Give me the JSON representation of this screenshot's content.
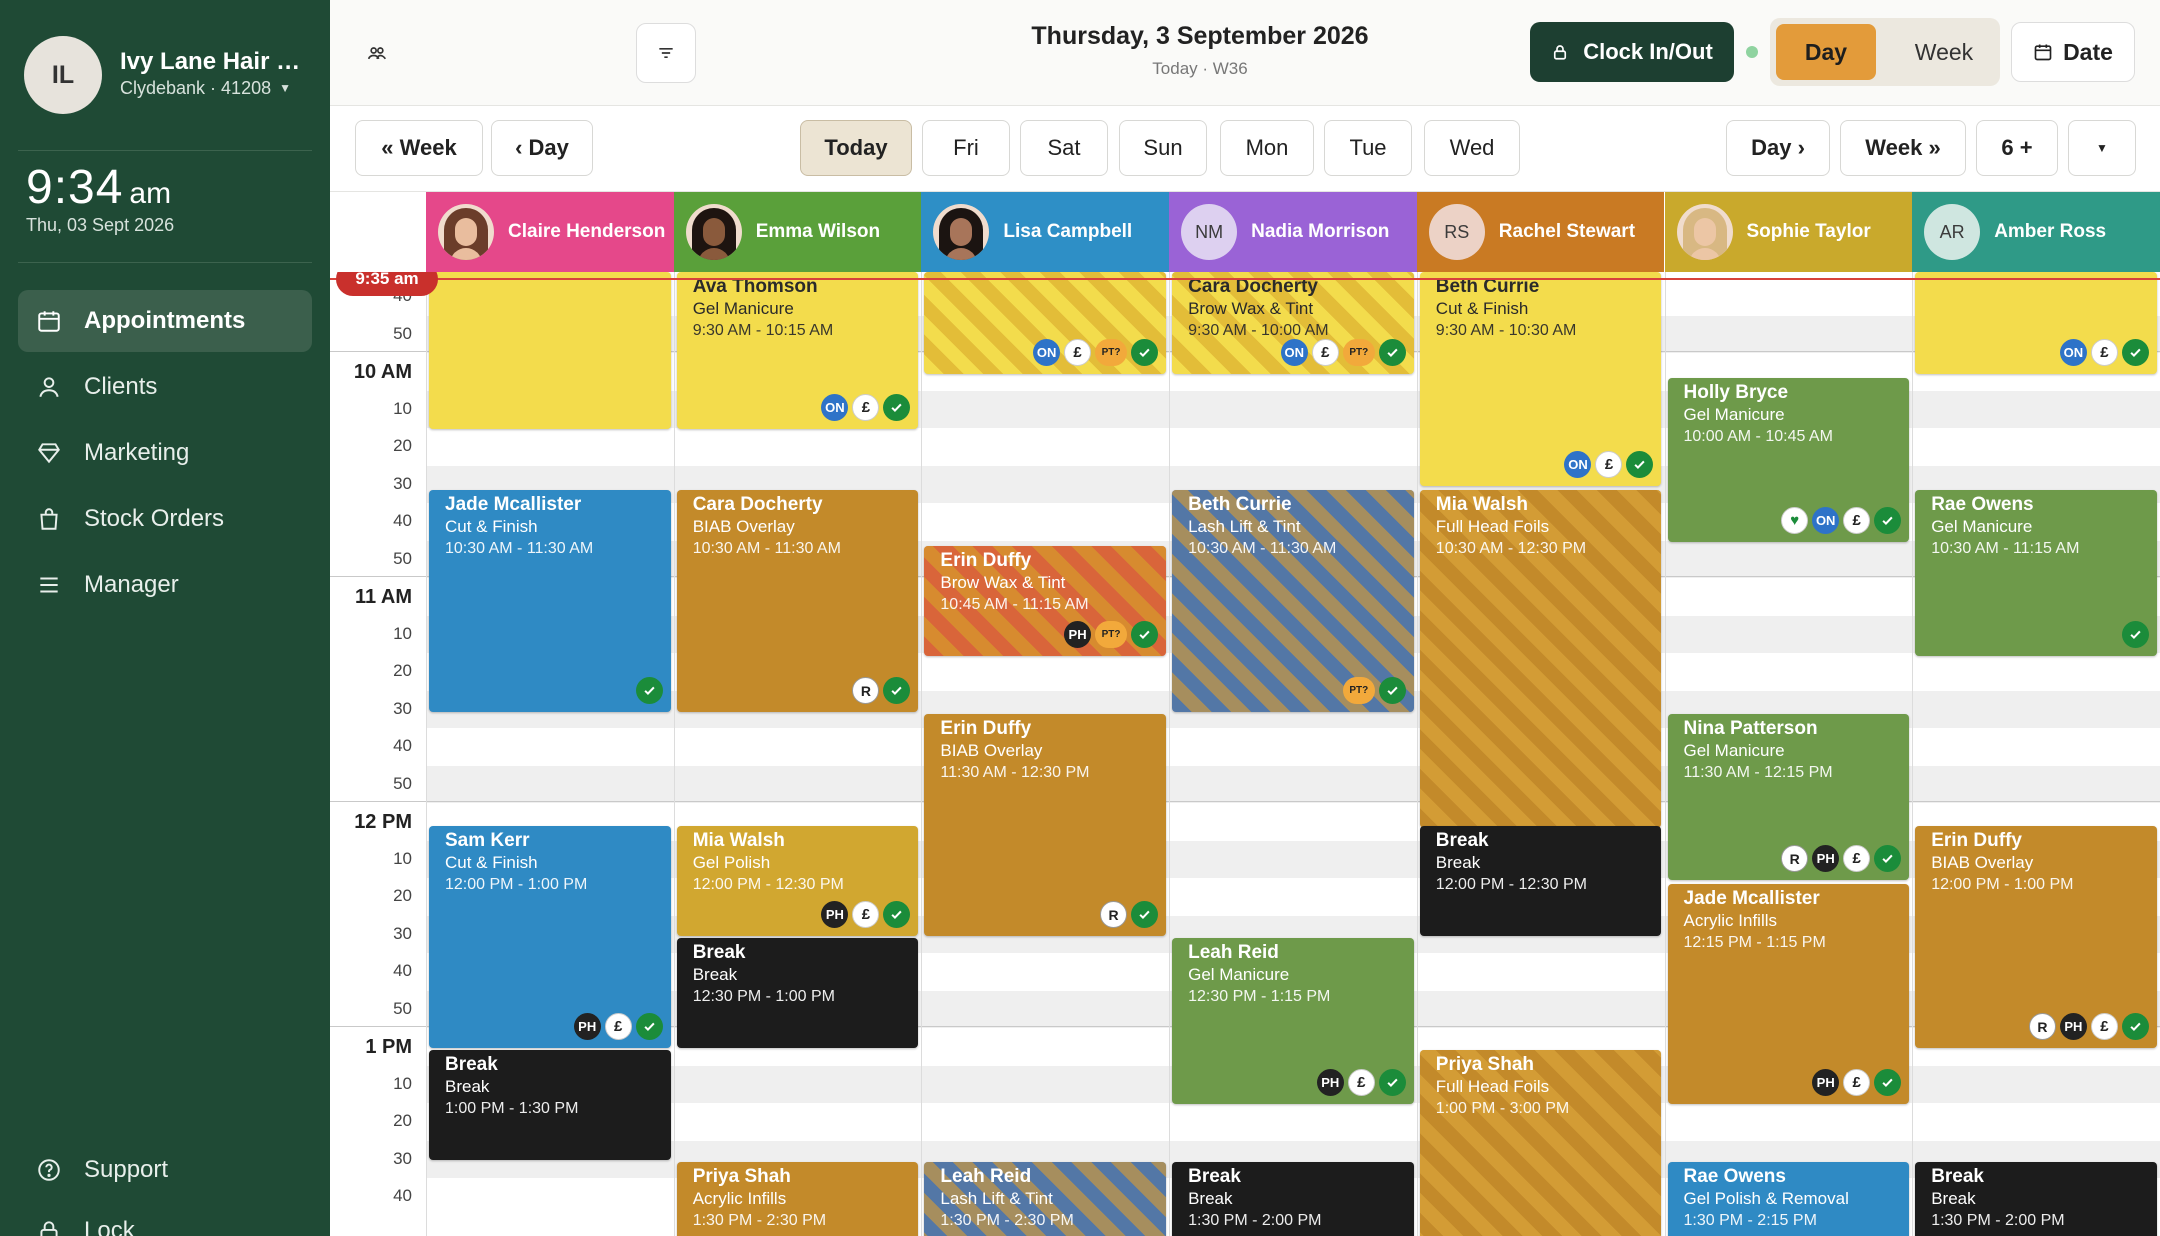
{
  "sidebar": {
    "avatar_initials": "IL",
    "salon_name": "Ivy Lane Hair & ...",
    "branch": "Clydebank · 41208",
    "time": "9:34",
    "ampm": "am",
    "date": "Thu, 03 Sept 2026",
    "nav": [
      "Appointments",
      "Clients",
      "Marketing",
      "Stock Orders",
      "Manager"
    ],
    "support": "Support",
    "lock": "Lock"
  },
  "header": {
    "title": "Thursday, 3 September 2026",
    "subtitle": "Today · W36",
    "clock_label": "Clock In/Out",
    "view_day": "Day",
    "view_week": "Week",
    "date_label": "Date"
  },
  "navbar": {
    "prev_week": "« Week",
    "prev_day": "‹ Day",
    "today": "Today",
    "days": [
      "Fri",
      "Sat",
      "Sun",
      "Mon",
      "Tue",
      "Wed"
    ],
    "next_day": "Day ›",
    "next_week": "Week »",
    "more": "6 +"
  },
  "staff": [
    {
      "name": "Claire Henderson",
      "color": "#e5488a"
    },
    {
      "name": "Emma Wilson",
      "color": "#5aa03a"
    },
    {
      "name": "Lisa Campbell",
      "color": "#2e8fc6"
    },
    {
      "name": "Nadia Morrison",
      "initials": "NM",
      "color": "#9a63d6"
    },
    {
      "name": "Rachel Stewart",
      "initials": "RS",
      "color": "#c97a23"
    },
    {
      "name": "Sophie Taylor",
      "color": "#c9a92c"
    },
    {
      "name": "Amber Ross",
      "initials": "AR",
      "color": "#2f9a87"
    }
  ],
  "time_labels": [
    "40",
    "50",
    "10 AM",
    "10",
    "20",
    "30",
    "40",
    "50",
    "11 AM",
    "10",
    "20",
    "30",
    "40",
    "50",
    "12 PM",
    "10",
    "20",
    "30",
    "40",
    "50",
    "1 PM",
    "10",
    "20",
    "30",
    "40"
  ],
  "now_label": "9:35 am",
  "appointments": [
    {
      "col": 0,
      "name": "",
      "service": "",
      "time": "",
      "start": 0,
      "end": 157,
      "color": "#f3dc4c",
      "text": "dark",
      "badges": []
    },
    {
      "col": 1,
      "name": "Ava Thomson",
      "service": "Gel Manicure",
      "time": "9:30 AM - 10:15 AM",
      "start": 0,
      "end": 157,
      "color": "#f3dc4c",
      "text": "dark",
      "badges": [
        "ON",
        "£",
        "ok"
      ]
    },
    {
      "col": 2,
      "name": "",
      "service": "",
      "time": "",
      "start": 0,
      "end": 102,
      "color": "#f3dc4c",
      "stripe": "rgba(214,164,40,0.55)",
      "text": "dark",
      "badges": [
        "ON",
        "£",
        "PT?",
        "ok"
      ]
    },
    {
      "col": 3,
      "name": "Cara Docherty",
      "service": "Brow Wax & Tint",
      "time": "9:30 AM - 10:00 AM",
      "start": 0,
      "end": 102,
      "color": "#f3dc4c",
      "stripe": "rgba(214,164,40,0.55)",
      "text": "dark",
      "badges": [
        "ON",
        "£",
        "PT?",
        "ok"
      ]
    },
    {
      "col": 4,
      "name": "Beth Currie",
      "service": "Cut & Finish",
      "time": "9:30 AM - 10:30 AM",
      "start": 0,
      "end": 214,
      "color": "#f3dc4c",
      "text": "dark",
      "badges": [
        "ON",
        "£",
        "ok"
      ]
    },
    {
      "col": 6,
      "name": "",
      "service": "",
      "time": "",
      "start": 0,
      "end": 102,
      "color": "#f3dc4c",
      "text": "dark",
      "badges": [
        "ON",
        "£",
        "ok"
      ]
    },
    {
      "col": 5,
      "name": "Holly Bryce",
      "service": "Gel Manicure",
      "time": "10:00 AM - 10:45 AM",
      "start": 106,
      "end": 270,
      "color": "#6e9a4a",
      "badges": [
        "heart",
        "ON",
        "£",
        "ok"
      ]
    },
    {
      "col": 0,
      "name": "Jade Mcallister",
      "service": "Cut & Finish",
      "time": "10:30 AM - 11:30 AM",
      "start": 218,
      "end": 440,
      "color": "#2f8ac4",
      "badges": [
        "ok"
      ]
    },
    {
      "col": 1,
      "name": "Cara Docherty",
      "service": "BIAB Overlay",
      "time": "10:30 AM - 11:30 AM",
      "start": 218,
      "end": 440,
      "color": "#c38a2a",
      "badges": [
        "R",
        "ok"
      ]
    },
    {
      "col": 3,
      "name": "Beth Currie",
      "service": "Lash Lift & Tint",
      "time": "10:30 AM - 11:30 AM",
      "start": 218,
      "end": 440,
      "color": "#5377a6",
      "stripe": "rgba(194,150,70,0.75)",
      "badges": [
        "PT?",
        "ok"
      ]
    },
    {
      "col": 4,
      "name": "Mia Walsh",
      "service": "Full Head Foils",
      "time": "10:30 AM - 12:30 PM",
      "start": 218,
      "end": 556,
      "color": "#c38a2a",
      "stripe": "rgba(222,168,60,0.6)",
      "badges": []
    },
    {
      "col": 6,
      "name": "Rae Owens",
      "service": "Gel Manicure",
      "time": "10:30 AM - 11:15 AM",
      "start": 218,
      "end": 384,
      "color": "#6e9a4a",
      "badges": [
        "ok"
      ]
    },
    {
      "col": 2,
      "name": "Erin Duffy",
      "service": "Brow Wax & Tint",
      "time": "10:45 AM - 11:15 AM",
      "start": 274,
      "end": 384,
      "color": "#d9653a",
      "stripe": "rgba(214,164,40,0.6)",
      "badges": [
        "PH",
        "PT?",
        "ok"
      ]
    },
    {
      "col": 2,
      "name": "Erin Duffy",
      "service": "BIAB Overlay",
      "time": "11:30 AM - 12:30 PM",
      "start": 442,
      "end": 664,
      "color": "#c38a2a",
      "badges": [
        "R",
        "ok"
      ]
    },
    {
      "col": 5,
      "name": "Nina Patterson",
      "service": "Gel Manicure",
      "time": "11:30 AM - 12:15 PM",
      "start": 442,
      "end": 608,
      "color": "#6e9a4a",
      "badges": [
        "R",
        "PH",
        "£",
        "ok"
      ]
    },
    {
      "col": 0,
      "name": "Sam Kerr",
      "service": "Cut & Finish",
      "time": "12:00 PM - 1:00 PM",
      "start": 554,
      "end": 776,
      "color": "#2f8ac4",
      "badges": [
        "PH",
        "£",
        "ok"
      ]
    },
    {
      "col": 1,
      "name": "Mia Walsh",
      "service": "Gel Polish",
      "time": "12:00 PM - 12:30 PM",
      "start": 554,
      "end": 664,
      "color": "#d1a730",
      "badges": [
        "PH",
        "£",
        "ok"
      ]
    },
    {
      "col": 4,
      "name": "Break",
      "service": "Break",
      "time": "12:00 PM - 12:30 PM",
      "start": 554,
      "end": 664,
      "color": "#1c1c1c",
      "badges": []
    },
    {
      "col": 6,
      "name": "Erin Duffy",
      "service": "BIAB Overlay",
      "time": "12:00 PM - 1:00 PM",
      "start": 554,
      "end": 776,
      "color": "#c38a2a",
      "badges": [
        "R",
        "PH",
        "£",
        "ok"
      ]
    },
    {
      "col": 5,
      "name": "Jade Mcallister",
      "service": "Acrylic Infills",
      "time": "12:15 PM - 1:15 PM",
      "start": 612,
      "end": 832,
      "color": "#c38a2a",
      "badges": [
        "PH",
        "£",
        "ok"
      ]
    },
    {
      "col": 1,
      "name": "Break",
      "service": "Break",
      "time": "12:30 PM - 1:00 PM",
      "start": 666,
      "end": 776,
      "color": "#1c1c1c",
      "badges": []
    },
    {
      "col": 3,
      "name": "Leah Reid",
      "service": "Gel Manicure",
      "time": "12:30 PM - 1:15 PM",
      "start": 666,
      "end": 832,
      "color": "#6e9a4a",
      "badges": [
        "PH",
        "£",
        "ok"
      ]
    },
    {
      "col": 0,
      "name": "Break",
      "service": "Break",
      "time": "1:00 PM - 1:30 PM",
      "start": 778,
      "end": 888,
      "color": "#1c1c1c",
      "badges": []
    },
    {
      "col": 4,
      "name": "Priya Shah",
      "service": "Full Head Foils",
      "time": "1:00 PM - 3:00 PM",
      "start": 778,
      "end": 1000,
      "color": "#c38a2a",
      "stripe": "rgba(222,168,60,0.6)",
      "badges": []
    },
    {
      "col": 1,
      "name": "Priya Shah",
      "service": "Acrylic Infills",
      "time": "1:30 PM - 2:30 PM",
      "start": 890,
      "end": 1000,
      "color": "#c38a2a",
      "badges": []
    },
    {
      "col": 2,
      "name": "Leah Reid",
      "service": "Lash Lift & Tint",
      "time": "1:30 PM - 2:30 PM",
      "start": 890,
      "end": 1000,
      "color": "#5377a6",
      "stripe": "rgba(194,150,70,0.75)",
      "badges": []
    },
    {
      "col": 3,
      "name": "Break",
      "service": "Break",
      "time": "1:30 PM - 2:00 PM",
      "start": 890,
      "end": 1000,
      "color": "#1c1c1c",
      "badges": []
    },
    {
      "col": 5,
      "name": "Rae Owens",
      "service": "Gel Polish & Removal",
      "time": "1:30 PM - 2:15 PM",
      "start": 890,
      "end": 1000,
      "color": "#2f8ac4",
      "badges": []
    },
    {
      "col": 6,
      "name": "Break",
      "service": "Break",
      "time": "1:30 PM - 2:00 PM",
      "start": 890,
      "end": 1000,
      "color": "#1c1c1c",
      "badges": []
    }
  ]
}
